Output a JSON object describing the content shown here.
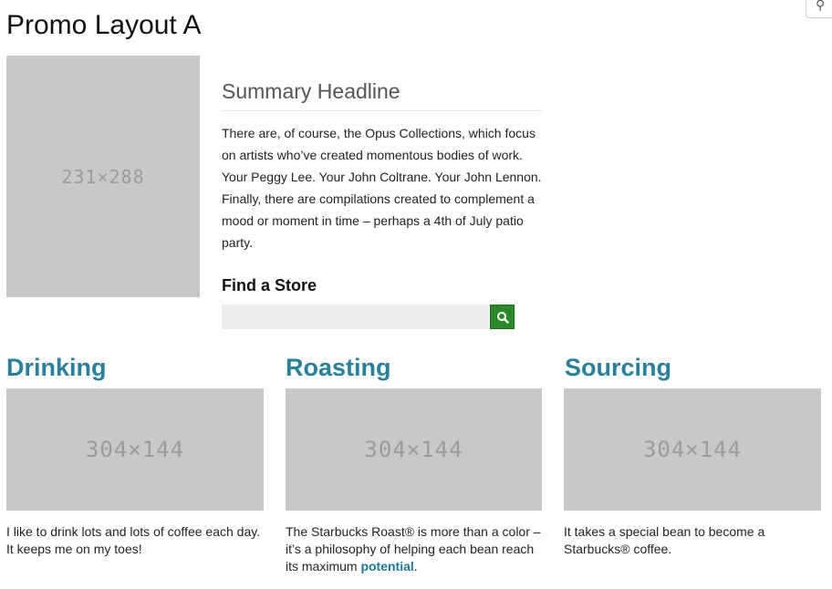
{
  "page": {
    "title": "Promo Layout A"
  },
  "corner_button": {
    "icon": "user-icon"
  },
  "hero": {
    "image_label": "231×288"
  },
  "summary": {
    "headline": "Summary Headline",
    "body": "There are, of course, the Opus Collections, which focus on artists who’ve created momentous bodies of work. Your Peggy Lee. Your John Coltrane. Your John Lennon. Finally, there are compilations created to complement a mood or moment in time – perhaps a 4th of July patio party."
  },
  "find_store": {
    "label": "Find a Store",
    "input_value": "",
    "button_icon": "search-icon",
    "button_color": "#2a8a2a"
  },
  "columns": [
    {
      "title": "Drinking",
      "image_label": "304×144",
      "text": "I like to drink lots and lots of coffee each day. It keeps me on my toes!"
    },
    {
      "title": "Roasting",
      "image_label": "304×144",
      "text": "The Starbucks Roast® is more than a color – it’s a philosophy of helping each bean reach its maximum ",
      "link": "potential",
      "text_end": "."
    },
    {
      "title": "Sourcing",
      "image_label": "304×144",
      "text": "It takes a special bean to become a Starbucks® coffee."
    }
  ],
  "colors": {
    "accent": "#2a7f9a",
    "placeholder_bg": "#c8c8c8",
    "placeholder_text": "#9b9b9b"
  }
}
